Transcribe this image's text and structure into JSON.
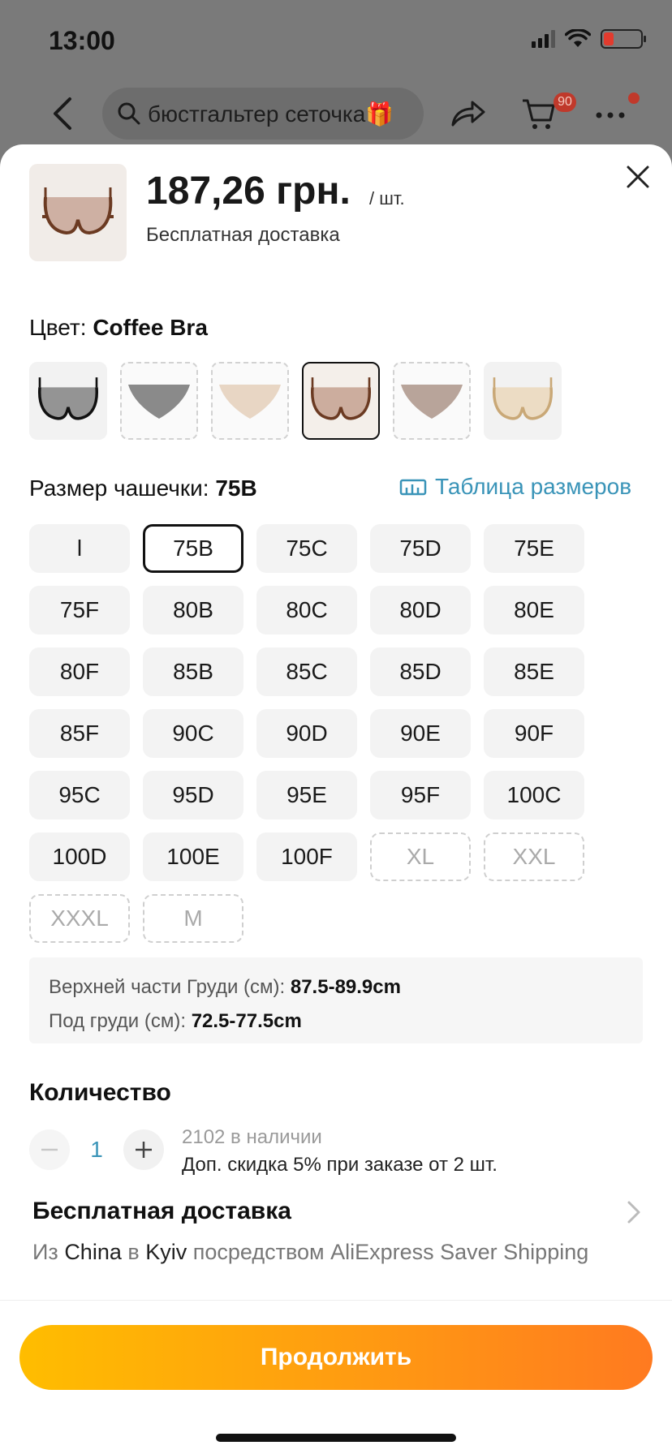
{
  "status_bar": {
    "time": "13:00"
  },
  "nav": {
    "search_text": "бюстгальтер сеточка🎁",
    "cart_count": "90"
  },
  "product": {
    "price": "187,26 грн.",
    "per_unit": "/ шт.",
    "shipping_note": "Бесплатная доставка"
  },
  "color": {
    "label": "Цвет:",
    "selected": "Coffee Bra",
    "swatches": [
      {
        "name": "black-bra",
        "state": "normal"
      },
      {
        "name": "gray-panty",
        "state": "unavailable"
      },
      {
        "name": "beige-panty",
        "state": "unavailable"
      },
      {
        "name": "coffee-bra",
        "state": "selected"
      },
      {
        "name": "coffee-panty",
        "state": "unavailable"
      },
      {
        "name": "nude-bra",
        "state": "normal"
      }
    ]
  },
  "size": {
    "label": "Размер чашечки:",
    "selected": "75B",
    "size_table_link": "Таблица размеров",
    "options": [
      "l",
      "75B",
      "75C",
      "75D",
      "75E",
      "75F",
      "80B",
      "80C",
      "80D",
      "80E",
      "80F",
      "85B",
      "85C",
      "85D",
      "85E",
      "85F",
      "90C",
      "90D",
      "90E",
      "90F",
      "95C",
      "95D",
      "95E",
      "95F",
      "100C",
      "100D",
      "100E",
      "100F",
      "XL",
      "XXL",
      "XXXL",
      "M"
    ],
    "unavailable": [
      "XL",
      "XXL",
      "XXXL",
      "M"
    ]
  },
  "measurements": {
    "bust_label": "Верхней части Груди (см):",
    "bust_value": "87.5-89.9cm",
    "underbust_label": "Под груди (см):",
    "underbust_value": "72.5-77.5cm"
  },
  "quantity": {
    "title": "Количество",
    "value": "1",
    "stock": "2102 в наличии",
    "discount": "Доп. скидка 5% при заказе от 2 шт."
  },
  "shipping": {
    "title": "Бесплатная доставка",
    "from_prefix": "Из",
    "from": "China",
    "to_prefix": "в",
    "to": "Kyiv",
    "method": "посредством AliExpress Saver Shipping"
  },
  "cta": {
    "label": "Продолжить"
  },
  "colors": {
    "accent_link": "#3a94b8",
    "cta_gradient_start": "#ffbd00",
    "cta_gradient_end": "#ff7a20",
    "badge": "#c0392b"
  }
}
